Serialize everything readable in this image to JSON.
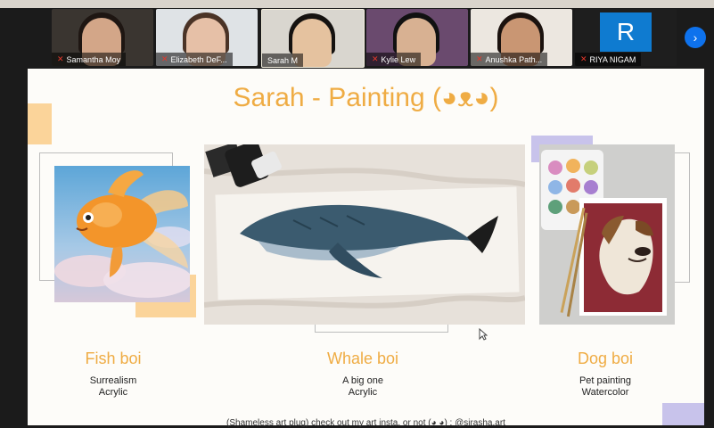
{
  "participants": [
    {
      "name": "Samantha Moy"
    },
    {
      "name": "Elizabeth DeF..."
    },
    {
      "name": "Sarah M"
    },
    {
      "name": "Kylie Lew"
    },
    {
      "name": "Anushka Path..."
    },
    {
      "name": "RIYA NIGAM",
      "avatar_letter": "R"
    }
  ],
  "nav": {
    "next_icon": "chevron-right-icon"
  },
  "slide": {
    "title": "Sarah - Painting (◕ᴥ◕)",
    "artworks": [
      {
        "title": "Fish boi",
        "line1": "Surrealism",
        "line2": "Acrylic"
      },
      {
        "title": "Whale boi",
        "line1": "A big one",
        "line2": "Acrylic"
      },
      {
        "title": "Dog boi",
        "line1": "Pet painting",
        "line2": "Watercolor"
      }
    ],
    "footnote": "(Shameless art plug) check out my art insta, or not (◕ ◕) : @sirasha.art"
  },
  "colors": {
    "accent": "#efac44",
    "deco_orange": "#fbd49a",
    "deco_lavender": "#c8c3eb",
    "zoom_blue": "#0e72ed"
  }
}
